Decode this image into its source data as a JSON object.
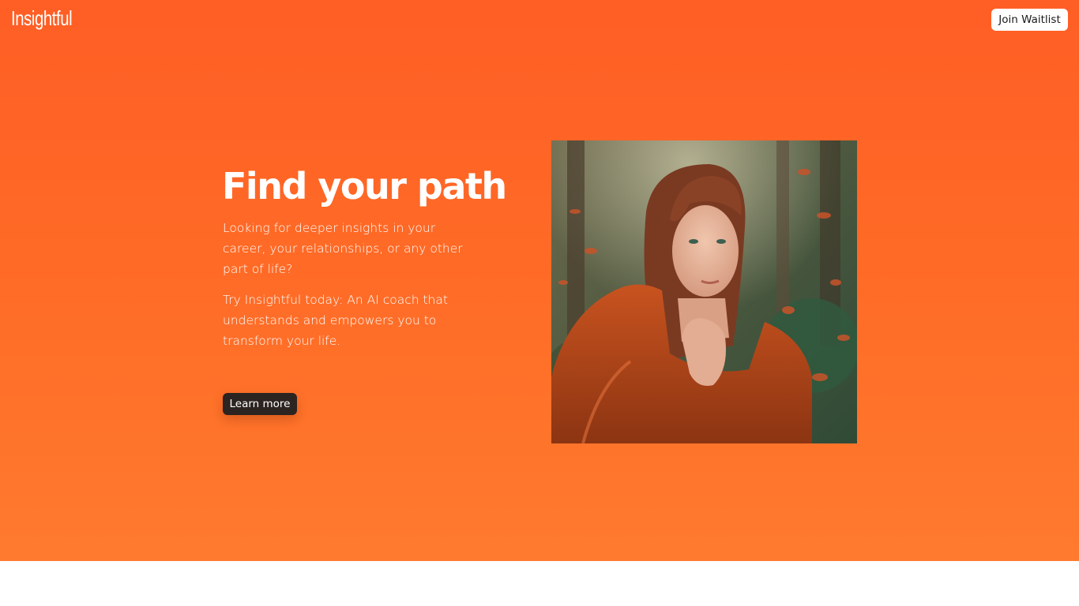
{
  "header": {
    "logo_text": "Insightful",
    "waitlist_label": "Join Waitlist"
  },
  "hero": {
    "headline": "Find your path",
    "paragraph_1": "Looking for deeper insights in your career, your relationships, or any other part of life?",
    "paragraph_2": "Try Insightful today: An AI coach that understands and empowers you to transform your life.",
    "cta_label": "Learn more",
    "image_icon": "photo-woman-forest"
  },
  "colors": {
    "hero_bg_top": "#ff5e25",
    "hero_bg_bottom": "#ff7a2e",
    "cta_bg": "#2c2420",
    "waitlist_bg": "#ffffff"
  }
}
